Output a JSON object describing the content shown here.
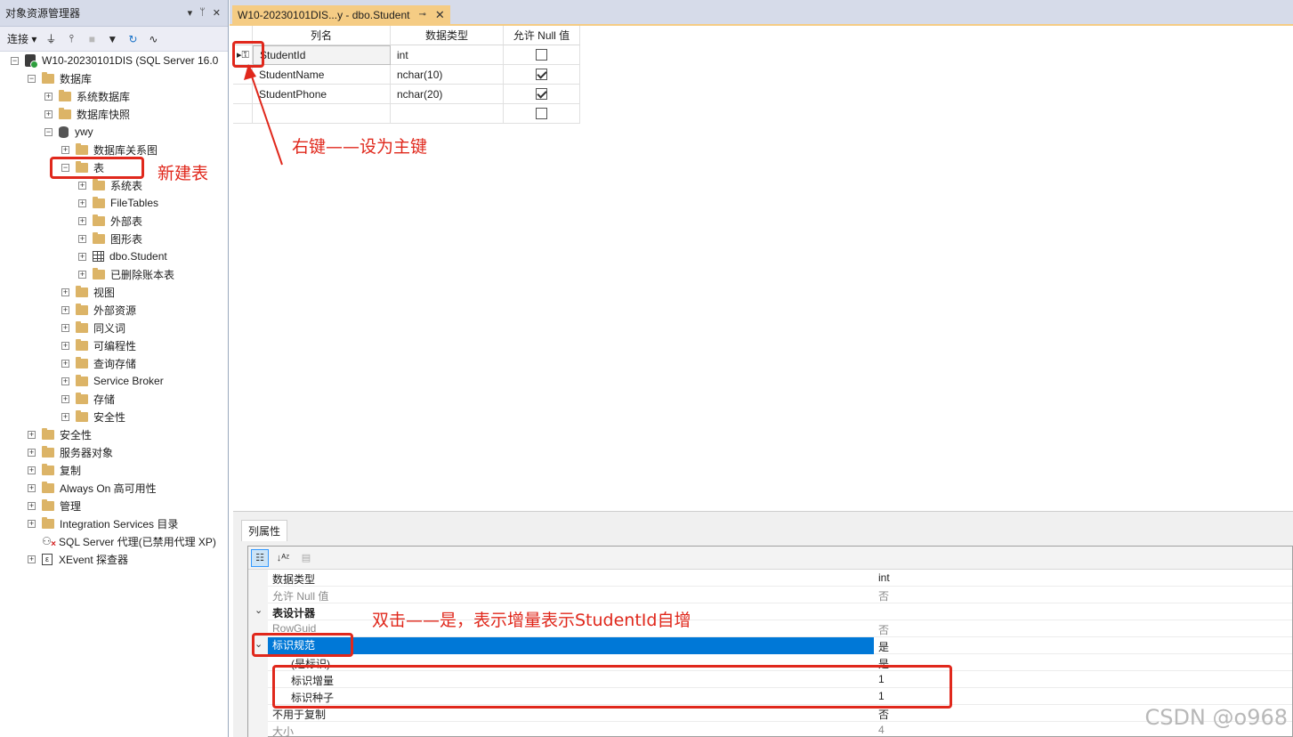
{
  "object_explorer": {
    "title": "对象资源管理器",
    "title_buttons": [
      "▾",
      "ᛘ",
      "✕"
    ],
    "connect_label": "连接 ▾",
    "tree": [
      {
        "label": "W10-20230101DIS (SQL Server 16.0",
        "level": 0,
        "exp": "⊟",
        "icon": "server-icon"
      },
      {
        "label": "数据库",
        "level": 1,
        "exp": "⊟",
        "icon": "folder-icon"
      },
      {
        "label": "系统数据库",
        "level": 2,
        "exp": "⊞",
        "icon": "folder-icon"
      },
      {
        "label": "数据库快照",
        "level": 2,
        "exp": "⊞",
        "icon": "folder-icon"
      },
      {
        "label": "ywy",
        "level": 2,
        "exp": "⊟",
        "icon": "database-icon"
      },
      {
        "label": "数据库关系图",
        "level": 3,
        "exp": "⊞",
        "icon": "folder-icon"
      },
      {
        "label": "表",
        "level": 3,
        "exp": "⊟",
        "icon": "folder-icon"
      },
      {
        "label": "系统表",
        "level": 4,
        "exp": "⊞",
        "icon": "folder-icon"
      },
      {
        "label": "FileTables",
        "level": 4,
        "exp": "⊞",
        "icon": "folder-icon"
      },
      {
        "label": "外部表",
        "level": 4,
        "exp": "⊞",
        "icon": "folder-icon"
      },
      {
        "label": "图形表",
        "level": 4,
        "exp": "⊞",
        "icon": "folder-icon"
      },
      {
        "label": "dbo.Student",
        "level": 4,
        "exp": "⊞",
        "icon": "table-icon"
      },
      {
        "label": "已删除账本表",
        "level": 4,
        "exp": "⊞",
        "icon": "folder-icon"
      },
      {
        "label": "视图",
        "level": 3,
        "exp": "⊞",
        "icon": "folder-icon"
      },
      {
        "label": "外部资源",
        "level": 3,
        "exp": "⊞",
        "icon": "folder-icon"
      },
      {
        "label": "同义词",
        "level": 3,
        "exp": "⊞",
        "icon": "folder-icon"
      },
      {
        "label": "可编程性",
        "level": 3,
        "exp": "⊞",
        "icon": "folder-icon"
      },
      {
        "label": "查询存储",
        "level": 3,
        "exp": "⊞",
        "icon": "folder-icon"
      },
      {
        "label": "Service Broker",
        "level": 3,
        "exp": "⊞",
        "icon": "folder-icon"
      },
      {
        "label": "存储",
        "level": 3,
        "exp": "⊞",
        "icon": "folder-icon"
      },
      {
        "label": "安全性",
        "level": 3,
        "exp": "⊞",
        "icon": "folder-icon"
      },
      {
        "label": "安全性",
        "level": 1,
        "exp": "⊞",
        "icon": "folder-icon"
      },
      {
        "label": "服务器对象",
        "level": 1,
        "exp": "⊞",
        "icon": "folder-icon"
      },
      {
        "label": "复制",
        "level": 1,
        "exp": "⊞",
        "icon": "folder-icon"
      },
      {
        "label": "Always On 高可用性",
        "level": 1,
        "exp": "⊞",
        "icon": "folder-icon"
      },
      {
        "label": "管理",
        "level": 1,
        "exp": "⊞",
        "icon": "folder-icon"
      },
      {
        "label": "Integration Services 目录",
        "level": 1,
        "exp": "⊞",
        "icon": "folder-icon"
      },
      {
        "label": "SQL Server 代理(已禁用代理 XP)",
        "level": 1,
        "exp": "",
        "icon": "agent-icon"
      },
      {
        "label": "XEvent 探查器",
        "level": 1,
        "exp": "⊞",
        "icon": "xevent-icon"
      }
    ]
  },
  "doc_tab": {
    "label": "W10-20230101DIS...y - dbo.Student",
    "pin": "⊸",
    "close": "✕"
  },
  "designer": {
    "headers": [
      "列名",
      "数据类型",
      "允许 Null 值"
    ],
    "rows": [
      {
        "name": "StudentId",
        "type": "int",
        "allow_null": false,
        "pk": true
      },
      {
        "name": "StudentName",
        "type": "nchar(10)",
        "allow_null": true,
        "pk": false
      },
      {
        "name": "StudentPhone",
        "type": "nchar(20)",
        "allow_null": true,
        "pk": false
      },
      {
        "name": "",
        "type": "",
        "allow_null": false,
        "pk": false
      }
    ]
  },
  "column_properties": {
    "tab_label": "列属性",
    "rows": [
      {
        "name": "数据类型",
        "value": "int",
        "kind": "normal"
      },
      {
        "name": "允许 Null 值",
        "value": "否",
        "kind": "dim"
      },
      {
        "name": "表设计器",
        "value": "",
        "kind": "cat"
      },
      {
        "name": "RowGuid",
        "value": "否",
        "kind": "dim"
      },
      {
        "name": "标识规范",
        "value": "是",
        "kind": "sel"
      },
      {
        "name": "(是标识)",
        "value": "是",
        "kind": "sub"
      },
      {
        "name": "标识增量",
        "value": "1",
        "kind": "sub"
      },
      {
        "name": "标识种子",
        "value": "1",
        "kind": "sub"
      },
      {
        "name": "不用于复制",
        "value": "否",
        "kind": "normal"
      },
      {
        "name": "大小",
        "value": "4",
        "kind": "dim"
      }
    ]
  },
  "annotations": {
    "new_table": "新建表",
    "set_primary_key": "右键——设为主键",
    "identity_note": "双击——是，表示增量表示StudentId自增"
  },
  "watermark": "CSDN @o968",
  "colors": {
    "accent_selection": "#0078d7",
    "annotation_red": "#e0281c",
    "tab_gold": "#f5cc84"
  }
}
